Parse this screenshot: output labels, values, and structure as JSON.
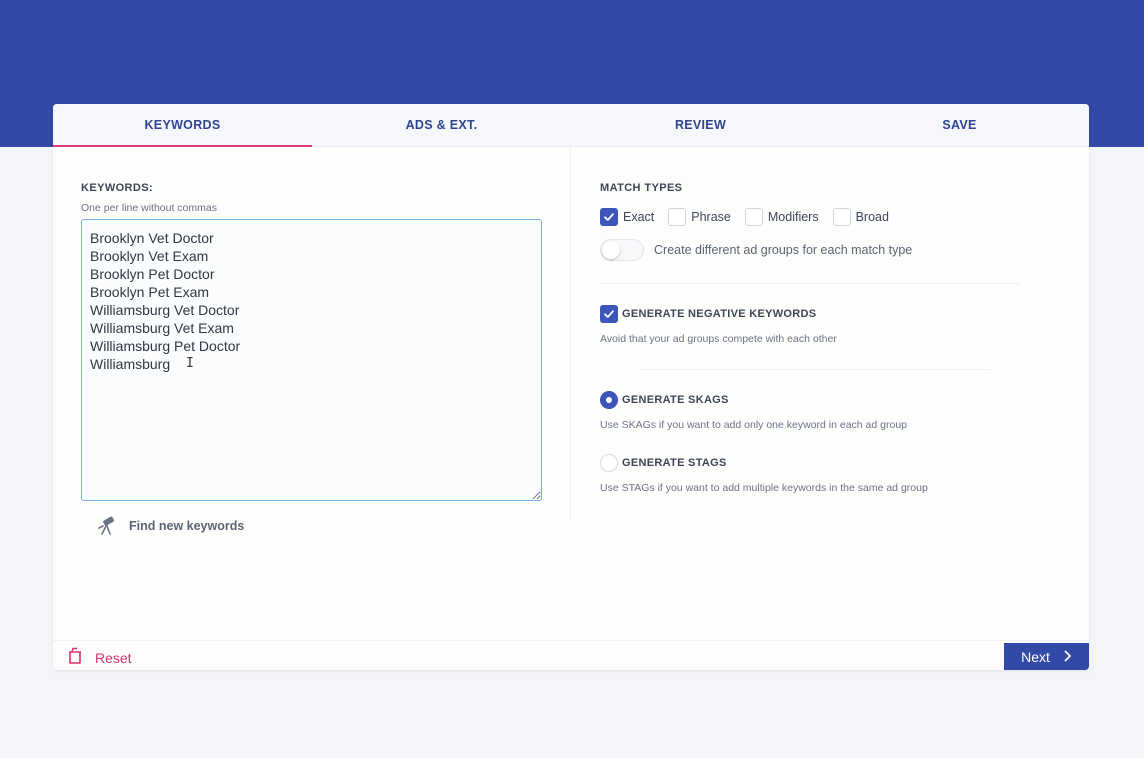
{
  "tabs": [
    {
      "label": "KEYWORDS",
      "active": true
    },
    {
      "label": "ADS & EXT.",
      "active": false
    },
    {
      "label": "REVIEW",
      "active": false
    },
    {
      "label": "SAVE",
      "active": false
    }
  ],
  "keywords": {
    "title": "KEYWORDS:",
    "subtitle": "One per line without commas",
    "value": "Brooklyn Vet Doctor\nBrooklyn Vet Exam\nBrooklyn Pet Doctor\nBrooklyn Pet Exam\nWilliamsburg Vet Doctor\nWilliamsburg Vet Exam\nWilliamsburg Pet Doctor\nWilliamsburg",
    "find_label": "Find new keywords"
  },
  "match_types": {
    "title": "MATCH TYPES",
    "options": [
      {
        "label": "Exact",
        "checked": true
      },
      {
        "label": "Phrase",
        "checked": false
      },
      {
        "label": "Modifiers",
        "checked": false
      },
      {
        "label": "Broad",
        "checked": false
      }
    ],
    "toggle_label": "Create different ad groups for each match type",
    "toggle_on": false
  },
  "negative": {
    "label": "GENERATE NEGATIVE KEYWORDS",
    "desc": "Avoid that your ad groups compete with each other",
    "checked": true
  },
  "skags": {
    "label": "GENERATE SKAGS",
    "desc": "Use SKAGs if you want to add only one keyword in each ad group",
    "selected": true
  },
  "stags": {
    "label": "GENERATE STAGS",
    "desc": "Use STAGs if you want to add multiple keywords in the same ad group",
    "selected": false
  },
  "footer": {
    "reset_label": "Reset",
    "next_label": "Next"
  },
  "colors": {
    "brand": "#3349a8",
    "accent": "#e0407a",
    "reset": "#d9346b"
  },
  "icons": {
    "find": "telescope-icon",
    "reset": "trash-icon",
    "next": "chevron-right-icon",
    "check": "check-icon"
  }
}
